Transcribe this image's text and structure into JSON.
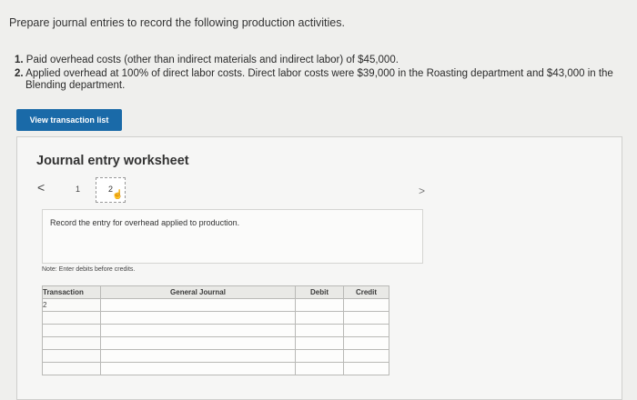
{
  "header": {
    "title": "Prepare journal entries to record the following production activities."
  },
  "tasks": [
    {
      "num": "1.",
      "text": "Paid overhead costs (other than indirect materials and indirect labor) of $45,000.",
      "cont": ""
    },
    {
      "num": "2.",
      "text": "Applied overhead at 100% of direct labor costs. Direct labor costs were $39,000 in the Roasting department and $43,000 in the",
      "cont": "Blending department."
    }
  ],
  "buttons": {
    "view_transactions": "View transaction list"
  },
  "worksheet": {
    "title": "Journal entry worksheet",
    "nav": {
      "prev": "<",
      "next": ">",
      "steps": [
        "1",
        "2"
      ],
      "current": "2"
    },
    "instruction": "Record the entry for overhead applied to production.",
    "note": "Note: Enter debits before credits.",
    "table": {
      "headers": [
        "Transaction",
        "General Journal",
        "Debit",
        "Credit"
      ],
      "rows": [
        {
          "transaction": "2",
          "account": "",
          "debit": "",
          "credit": ""
        },
        {
          "transaction": "",
          "account": "",
          "debit": "",
          "credit": ""
        },
        {
          "transaction": "",
          "account": "",
          "debit": "",
          "credit": ""
        },
        {
          "transaction": "",
          "account": "",
          "debit": "",
          "credit": ""
        },
        {
          "transaction": "",
          "account": "",
          "debit": "",
          "credit": ""
        },
        {
          "transaction": "",
          "account": "",
          "debit": "",
          "credit": ""
        }
      ]
    }
  },
  "colors": {
    "button_bg": "#1a6aa8",
    "page_bg": "#efefed"
  }
}
